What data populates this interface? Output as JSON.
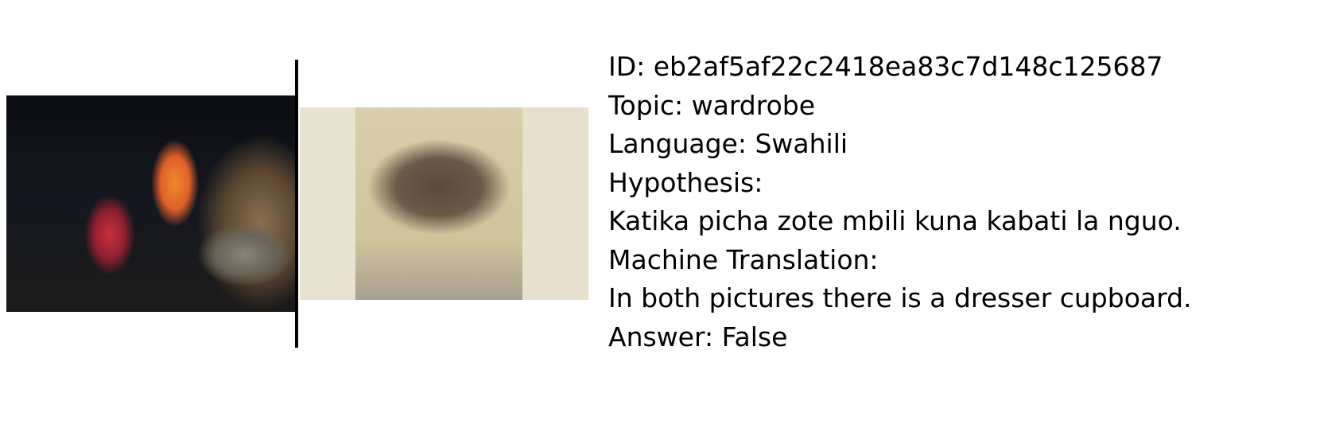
{
  "images": {
    "left": {
      "description_icon": "photo-left"
    },
    "right": {
      "description_icon": "photo-right"
    }
  },
  "info": {
    "id_line": "ID: eb2af5af22c2418ea83c7d148c125687",
    "topic_line": "Topic: wardrobe",
    "language_line": "Language: Swahili",
    "hypothesis_label": "Hypothesis:",
    "hypothesis": "Katika picha zote mbili kuna kabati la nguo.",
    "translation_label": "Machine Translation:",
    "translation": "In both pictures there is a dresser cupboard.",
    "answer_line": "Answer: False"
  }
}
